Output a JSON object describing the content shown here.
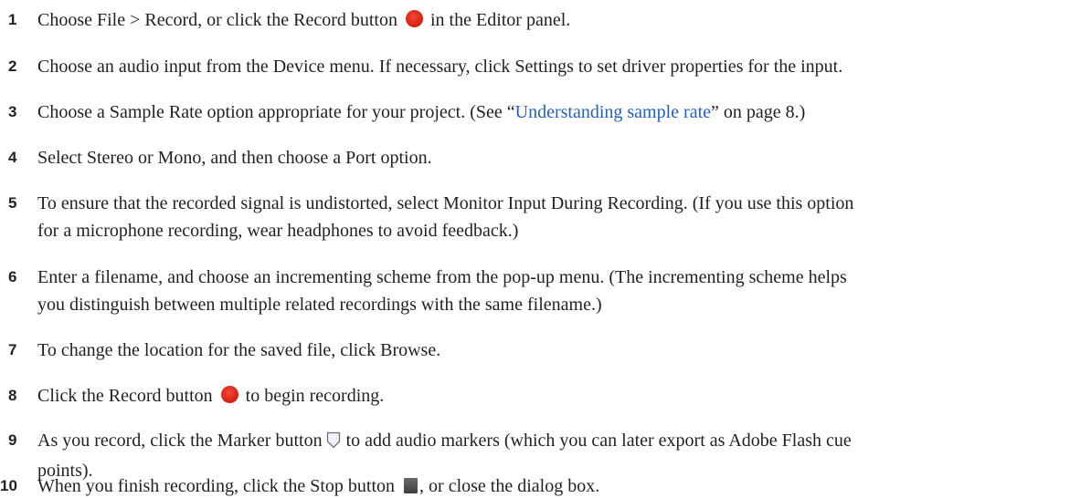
{
  "steps": [
    {
      "number": "1",
      "before": "Choose File > Record, or click the Record button",
      "icon": "record-icon",
      "after": "in the Editor panel."
    },
    {
      "number": "2",
      "text": "Choose an audio input from the Device menu. If necessary, click Settings to set driver properties for the input."
    },
    {
      "number": "3",
      "before": "Choose a Sample Rate option appropriate for your project. (See “",
      "link": "Understanding sample rate",
      "after": "” on page 8.)"
    },
    {
      "number": "4",
      "text": "Select Stereo or Mono, and then choose a Port option."
    },
    {
      "number": "5",
      "line1": "To ensure that the recorded signal is undistorted, select Monitor Input During Recording. (If you use this option",
      "line2": "for a microphone recording, wear headphones to avoid feedback.)"
    },
    {
      "number": "6",
      "line1": "Enter a filename, and choose an incrementing scheme from the pop-up menu. (The incrementing scheme helps",
      "line2": "you distinguish between multiple related recordings with the same filename.)"
    },
    {
      "number": "7",
      "text": "To change the location for the saved file, click Browse."
    },
    {
      "number": "8",
      "before": "Click the Record button",
      "icon": "record-icon",
      "after": "to begin recording."
    },
    {
      "number": "9",
      "before": "As you record, click the Marker button",
      "icon": "marker-icon",
      "after": "to add audio markers (which you can later export as Adobe Flash cue",
      "line2": "points)."
    },
    {
      "number": "10",
      "before": "When you finish recording, click the Stop button",
      "icon": "stop-icon",
      "after": ", or close the dialog box."
    }
  ],
  "colors": {
    "text": "#231f20",
    "link": "#1f5fc7",
    "record": "#dd2517",
    "stop": "#4a4a4a"
  }
}
